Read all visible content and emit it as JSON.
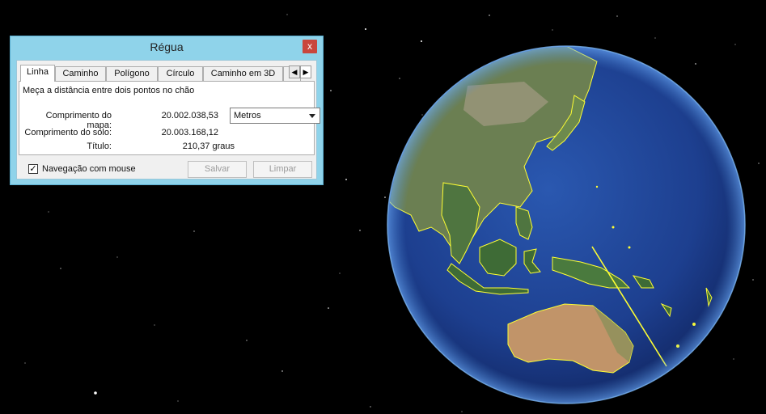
{
  "dialog": {
    "title": "Régua",
    "close_label": "x",
    "tabs": [
      "Linha",
      "Caminho",
      "Polígono",
      "Círculo",
      "Caminho em 3D"
    ],
    "active_tab": 0,
    "description": "Meça a distância entre dois pontos no chão",
    "map_length_label": "Comprimento do mapa:",
    "map_length_value": "20.002.038,53",
    "unit_select": "Metros",
    "ground_length_label": "Comprimento do solo:",
    "ground_length_value": "20.003.168,12",
    "heading_label": "Título:",
    "heading_value": "210,37 graus",
    "mouse_nav_label": "Navegação com mouse",
    "mouse_nav_checked": true,
    "save_label": "Salvar",
    "clear_label": "Limpar"
  },
  "globe": {
    "ocean_color": "#1d3f8f",
    "border_color": "#ffff33",
    "land_color": "#6e8a4e",
    "desert_color": "#c19469"
  }
}
